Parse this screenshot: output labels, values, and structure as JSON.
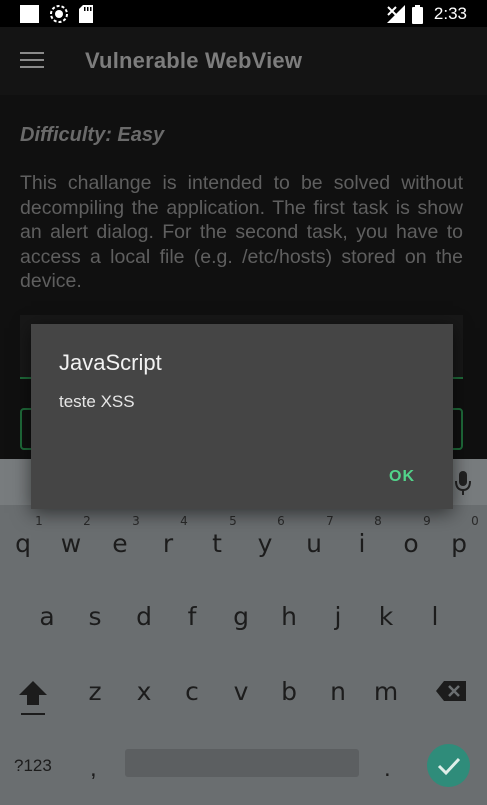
{
  "status_bar": {
    "time": "2:33"
  },
  "app_bar": {
    "title": "Vulnerable WebView",
    "menu_icon": "hamburger-menu-icon"
  },
  "content": {
    "difficulty": "Difficulty: Easy",
    "description": "This challange is intended to be solved without decompiling the application. The first task is show an alert dialog. For the second task, you have to access a local file (e.g. /etc/hosts) stored on the device."
  },
  "dialog": {
    "title": "JavaScript",
    "message": "teste XSS",
    "ok_label": "OK"
  },
  "keyboard": {
    "row1": [
      "q",
      "w",
      "e",
      "r",
      "t",
      "y",
      "u",
      "i",
      "o",
      "p"
    ],
    "row1_hints": [
      "1",
      "2",
      "3",
      "4",
      "5",
      "6",
      "7",
      "8",
      "9",
      "0"
    ],
    "row2": [
      "a",
      "s",
      "d",
      "f",
      "g",
      "h",
      "j",
      "k",
      "l"
    ],
    "row3": [
      "z",
      "x",
      "c",
      "v",
      "b",
      "n",
      "m"
    ],
    "symbols_label": "?123",
    "comma": ",",
    "period": "."
  },
  "colors": {
    "accent_green": "#52d38a",
    "dialog_bg": "#454545",
    "done_button": "#2f8c7a"
  }
}
